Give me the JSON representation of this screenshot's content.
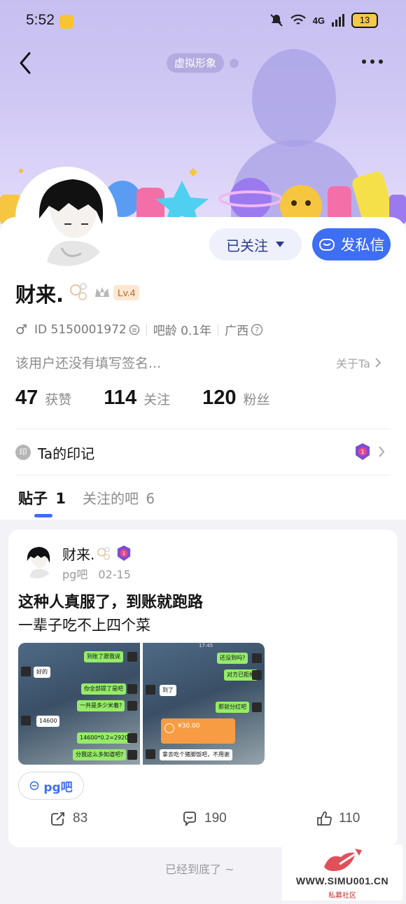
{
  "status_bar": {
    "time": "5:52",
    "battery": "13",
    "network": "4G"
  },
  "header": {
    "virtual_tag": "虚拟形象"
  },
  "profile": {
    "name": "财来.",
    "level": "Lv.4",
    "gender_symbol": "♂",
    "id_text": "ID 5150001972",
    "bar_age": "吧龄 0.1年",
    "location": "广西",
    "signature": "该用户还没有填写签名...",
    "about_label": "关于Ta",
    "follow_label": "已关注",
    "message_label": "发私信",
    "stats": [
      {
        "num": "47",
        "label": "获赞"
      },
      {
        "num": "114",
        "label": "关注"
      },
      {
        "num": "120",
        "label": "粉丝"
      }
    ],
    "seal_icon_text": "印",
    "seal_label": "Ta的印记"
  },
  "tabs": {
    "posts_label": "贴子",
    "posts_count": "1",
    "bars_label": "关注的吧",
    "bars_count": "6"
  },
  "post": {
    "author": "财来.",
    "bar_name": "pg吧",
    "date": "02-15",
    "title": "这种人真服了，到账就跑路",
    "body": "一辈子吃不上四个菜",
    "chip_label": "pg吧",
    "share_count": "83",
    "comment_count": "190",
    "like_count": "110",
    "image1_bubbles": [
      "到账了跟我说",
      "好的",
      "你全部提了是吧",
      "一共是多少米着?",
      "14600",
      "14600*0.2=2920",
      "分我这么多知道吧?"
    ],
    "image2_bubbles": [
      "还没到吗?",
      "对方已拒绝",
      "到了",
      "那就分红吧",
      "¥30.00",
      "拿去吃个猪脚饭吧，不用谢"
    ],
    "image2_time": "17:45"
  },
  "footer": {
    "end_text": "已经到底了 ~"
  },
  "watermark": {
    "url": "WWW.SIMU001.CN",
    "sub": "私募社区"
  },
  "colors": {
    "accent": "#3d6ef4",
    "banner": "#c7bff0",
    "level_badge": "#fde7d1"
  }
}
